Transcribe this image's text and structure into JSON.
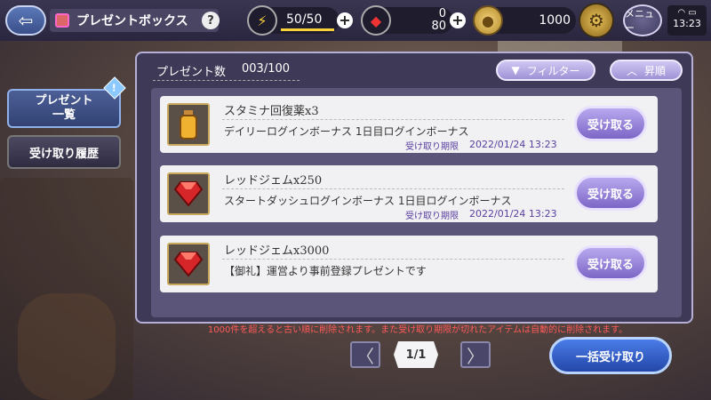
{
  "header": {
    "title": "プレゼントボックス",
    "help": "?",
    "stamina": "50/50",
    "gem_top": "0",
    "gem_bottom": "80",
    "gold": "1000",
    "menu": "メニュー",
    "time": "13:23",
    "plus": "+",
    "back": "⇦"
  },
  "sidebar": {
    "tabs": [
      {
        "label_line1": "プレゼント",
        "label_line2": "一覧"
      },
      {
        "label": "受け取り履歴"
      }
    ],
    "badge": "!"
  },
  "panel": {
    "count_label": "プレゼント数",
    "count_value": "003/100",
    "filter_label": "フィルター",
    "sort_label": "昇順",
    "items": [
      {
        "name": "スタミナ回復薬x3",
        "desc": "デイリーログインボーナス 1日目ログインボーナス",
        "expiry_label": "受け取り期限",
        "expiry": "2022/01/24 13:23",
        "receive": "受け取る",
        "icon": "potion-icon"
      },
      {
        "name": "レッドジェムx250",
        "desc": "スタートダッシュログインボーナス 1日目ログインボーナス",
        "expiry_label": "受け取り期限",
        "expiry": "2022/01/24 13:23",
        "receive": "受け取る",
        "icon": "red-gem-icon"
      },
      {
        "name": "レッドジェムx3000",
        "desc": "【御礼】運営より事前登録プレゼントです",
        "receive": "受け取る",
        "icon": "red-gem-icon"
      }
    ]
  },
  "notice": "1000件を超えると古い順に削除されます。また受け取り期限が切れたアイテムは自動的に削除されます。",
  "pager": {
    "page": "1/1",
    "prev": "〈",
    "next": "〉"
  },
  "bulk_receive": "一括受け取り"
}
